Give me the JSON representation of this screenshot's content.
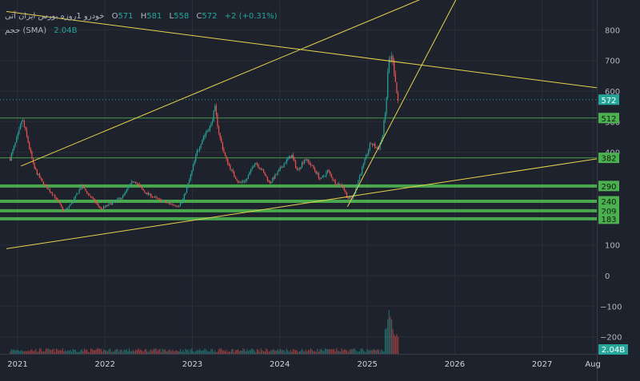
{
  "legend": {
    "symbol": "خودرو 1روزه بورس ایران آتی",
    "open_label": "O",
    "open_value": "571",
    "high_label": "H",
    "high_value": "581",
    "low_label": "L",
    "low_value": "558",
    "close_label": "C",
    "close_value": "572",
    "change": "+2 (+0.31%)",
    "volume_title": "حجم (SMA)",
    "volume_value": "2.04B"
  },
  "colors": {
    "background": "#1e222d",
    "up": "#26a69a",
    "down": "#ef5350",
    "trendline": "#e8d44d",
    "level": "#4caf50",
    "grid": "#2a2e39",
    "axis_text": "#b2b5be"
  },
  "chart_data": {
    "type": "candlestick",
    "x_ticks": [
      "2021",
      "2022",
      "2023",
      "2024",
      "2025",
      "2026",
      "2027",
      "Aug"
    ],
    "price_ticks": [
      400,
      500,
      600,
      700,
      800
    ],
    "volume_ticks": [
      -200,
      -100,
      0,
      100
    ],
    "ylim": [
      150,
      850
    ],
    "horizontal_levels": [
      512,
      382,
      290,
      240,
      209,
      183
    ],
    "last_price": 572,
    "last_volume": "2.04B",
    "price_path": [
      [
        "2020-12-01",
        380
      ],
      [
        "2021-01-05",
        460
      ],
      [
        "2021-01-20",
        510
      ],
      [
        "2021-02-15",
        430
      ],
      [
        "2021-03-10",
        350
      ],
      [
        "2021-04-15",
        300
      ],
      [
        "2021-06-01",
        260
      ],
      [
        "2021-07-15",
        205
      ],
      [
        "2021-08-20",
        240
      ],
      [
        "2021-09-25",
        290
      ],
      [
        "2021-11-01",
        255
      ],
      [
        "2021-12-15",
        215
      ],
      [
        "2022-02-01",
        235
      ],
      [
        "2022-03-15",
        255
      ],
      [
        "2022-05-01",
        310
      ],
      [
        "2022-06-15",
        270
      ],
      [
        "2022-08-01",
        250
      ],
      [
        "2022-09-15",
        235
      ],
      [
        "2022-11-01",
        225
      ],
      [
        "2022-11-20",
        240
      ],
      [
        "2022-12-20",
        310
      ],
      [
        "2023-01-20",
        400
      ],
      [
        "2023-02-15",
        450
      ],
      [
        "2023-03-20",
        490
      ],
      [
        "2023-04-05",
        545
      ],
      [
        "2023-04-25",
        450
      ],
      [
        "2023-05-20",
        380
      ],
      [
        "2023-06-20",
        330
      ],
      [
        "2023-07-15",
        300
      ],
      [
        "2023-08-15",
        310
      ],
      [
        "2023-09-20",
        370
      ],
      [
        "2023-10-20",
        340
      ],
      [
        "2023-11-20",
        300
      ],
      [
        "2023-12-20",
        330
      ],
      [
        "2024-01-25",
        370
      ],
      [
        "2024-02-20",
        390
      ],
      [
        "2024-03-15",
        340
      ],
      [
        "2024-04-15",
        380
      ],
      [
        "2024-05-20",
        350
      ],
      [
        "2024-06-20",
        310
      ],
      [
        "2024-07-20",
        340
      ],
      [
        "2024-08-20",
        300
      ],
      [
        "2024-09-20",
        290
      ],
      [
        "2024-10-10",
        250
      ],
      [
        "2024-11-01",
        250
      ],
      [
        "2024-11-20",
        300
      ],
      [
        "2024-12-20",
        370
      ],
      [
        "2025-01-15",
        430
      ],
      [
        "2025-02-15",
        410
      ],
      [
        "2025-03-05",
        450
      ],
      [
        "2025-03-20",
        560
      ],
      [
        "2025-03-30",
        690
      ],
      [
        "2025-04-08",
        715
      ],
      [
        "2025-04-20",
        690
      ],
      [
        "2025-05-01",
        600
      ],
      [
        "2025-05-10",
        572
      ]
    ],
    "trend_lines": [
      {
        "from": [
          "2020-11-15",
          860
        ],
        "to": [
          "2027-09-15",
          608
        ]
      },
      {
        "from": [
          "2021-01-15",
          355
        ],
        "to": [
          "2026-06-15",
          1000
        ]
      },
      {
        "from": [
          "2020-11-15",
          85
        ],
        "to": [
          "2027-09-15",
          382
        ]
      },
      {
        "from": [
          "2024-10-10",
          222
        ],
        "to": [
          "2026-03-15",
          1000
        ]
      }
    ]
  }
}
